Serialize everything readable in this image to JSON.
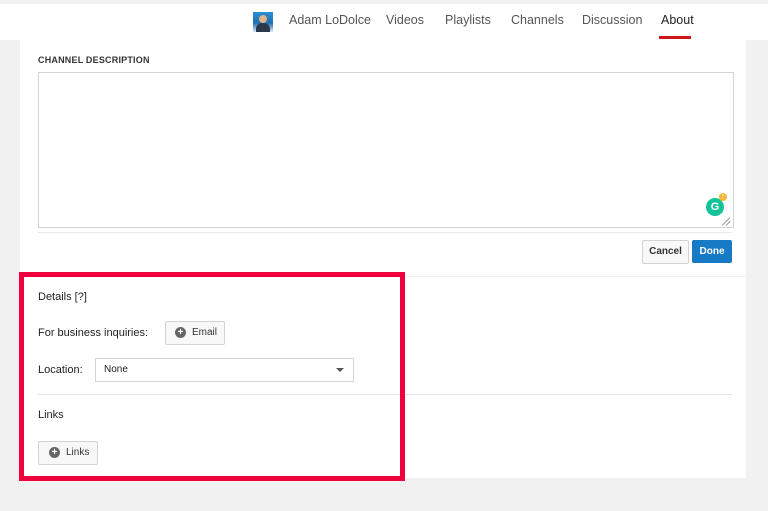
{
  "nav": {
    "channel_name": "Adam LoDolce",
    "items": [
      "Videos",
      "Playlists",
      "Channels",
      "Discussion",
      "About"
    ],
    "active": "About"
  },
  "description": {
    "title": "CHANNEL DESCRIPTION",
    "value": "",
    "cancel_label": "Cancel",
    "done_label": "Done"
  },
  "details": {
    "title": "Details [?]",
    "business_label": "For business inquiries:",
    "email_button": "Email",
    "location_label": "Location:",
    "location_value": "None",
    "links_title": "Links",
    "links_button": "Links"
  },
  "colors": {
    "accent": "#167ac6",
    "active_tab": "#cc181e",
    "highlight": "#f0003c"
  }
}
